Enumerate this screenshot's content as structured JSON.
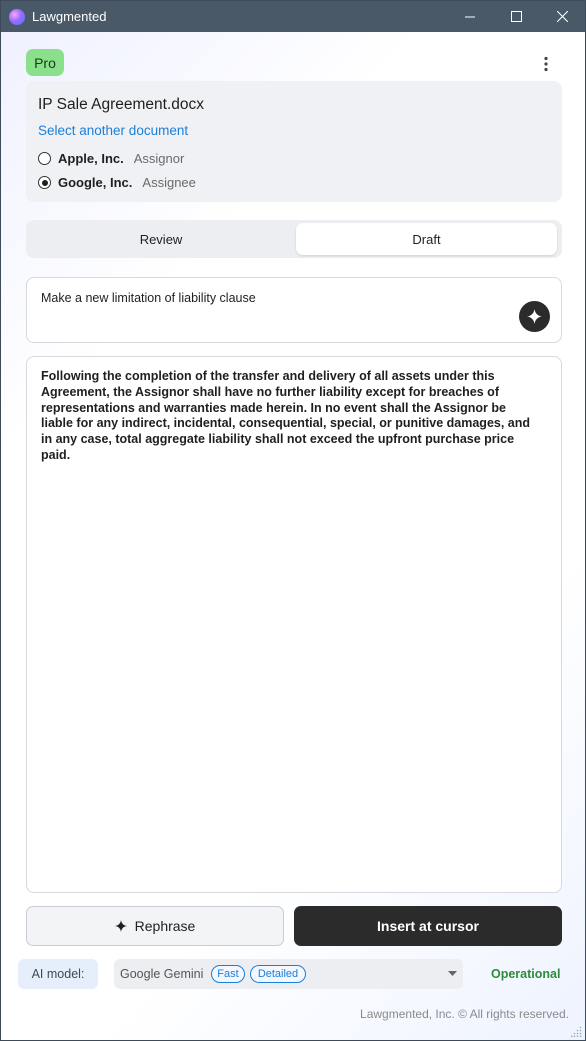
{
  "window": {
    "title": "Lawgmented",
    "controls": [
      "minimize-icon",
      "maximize-icon",
      "close-icon"
    ]
  },
  "header": {
    "plan_badge": "Pro",
    "menu_icon": "more-vertical-icon"
  },
  "document": {
    "title": "IP Sale Agreement.docx",
    "change_link": "Select another document",
    "parties": [
      {
        "name": "Apple, Inc.",
        "role": "Assignor",
        "selected": false
      },
      {
        "name": "Google, Inc.",
        "role": "Assignee",
        "selected": true
      }
    ]
  },
  "tabs": [
    {
      "label": "Review",
      "active": false
    },
    {
      "label": "Draft",
      "active": true
    }
  ],
  "prompt": {
    "text": "Make a new limitation of liability clause",
    "send_icon": "sparkle-icon"
  },
  "output": {
    "text": "Following the completion of the transfer and delivery of all assets under this Agreement, the Assignor shall have no further liability except for breaches of representations and warranties made herein. In no event shall the Assignor be liable for any indirect, incidental, consequential, special, or punitive damages, and in any case, total aggregate liability shall not exceed the upfront purchase price paid."
  },
  "actions": {
    "rephrase_label": "Rephrase",
    "insert_label": "Insert at cursor"
  },
  "model": {
    "label": "AI model:",
    "selected": "Google Gemini",
    "tags": [
      "Fast",
      "Detailed"
    ],
    "status": "Operational"
  },
  "footer": {
    "text": "Lawgmented, Inc. © All rights reserved."
  },
  "colors": {
    "accent": "#1a7fd8",
    "pro_badge": "#8be08b",
    "status_ok": "#2e8b3a",
    "primary_button": "#2b2b2b",
    "titlebar": "#4a5968"
  }
}
